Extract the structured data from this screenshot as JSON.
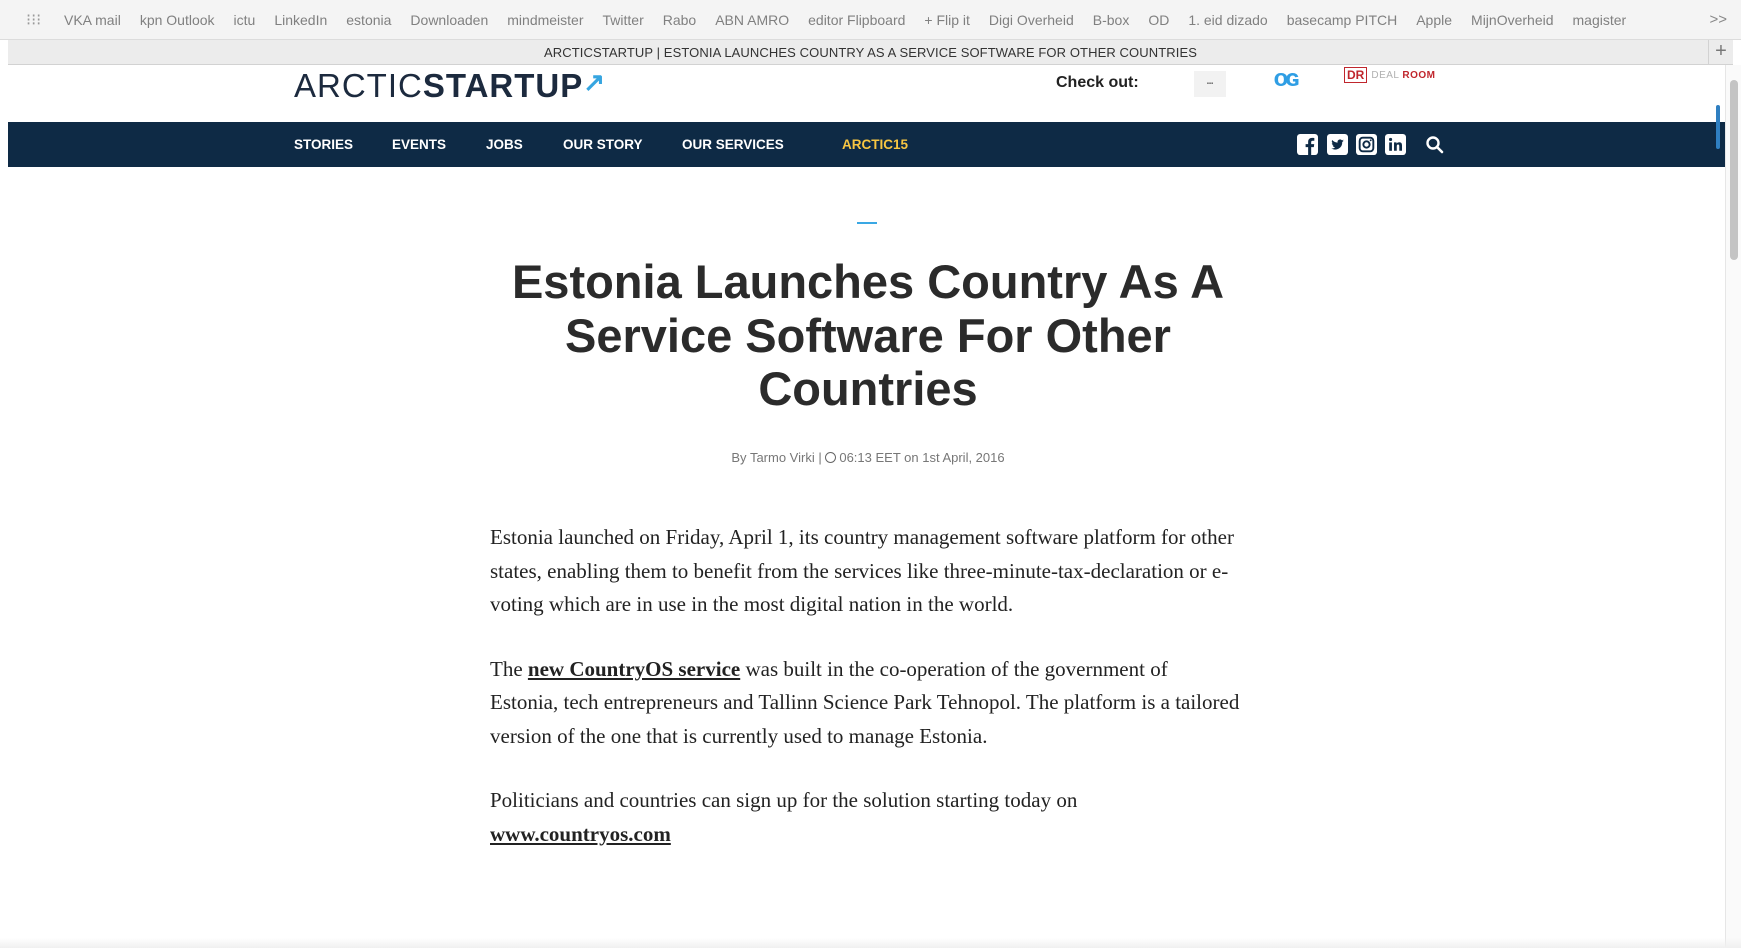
{
  "bookmarks": [
    "VKA mail",
    "kpn Outlook",
    "ictu",
    "LinkedIn",
    "estonia",
    "Downloaden",
    "mindmeister",
    "Twitter",
    "Rabo",
    "ABN AMRO",
    "editor Flipboard",
    "+ Flip it",
    "Digi Overheid",
    "B-box",
    "OD",
    "1. eid dizado",
    "basecamp PITCH",
    "Apple",
    "MijnOverheid",
    "magister"
  ],
  "tab": {
    "title": "ARCTICSTARTUP | ESTONIA LAUNCHES COUNTRY AS A SERVICE SOFTWARE FOR OTHER COUNTRIES"
  },
  "header": {
    "logo_light": "ARCTIC",
    "logo_bold": "STARTUP",
    "checkout_label": "Check out:",
    "partner_dr": "DR",
    "partner_deal": "DEAL",
    "partner_room": "ROOM"
  },
  "nav": {
    "items": [
      "STORIES",
      "EVENTS",
      "JOBS",
      "OUR STORY",
      "OUR SERVICES",
      "ARCTIC15"
    ],
    "accent_color": "#f7c642",
    "background": "#0e2a45",
    "social_icons": [
      "facebook-icon",
      "twitter-icon",
      "instagram-icon",
      "linkedin-icon",
      "search-icon"
    ]
  },
  "article": {
    "title": "Estonia Launches Country As A Service Software For Other Countries",
    "byline_prefix": "By",
    "author": "Tarmo Virki",
    "time": "06:13 EET on 1st April, 2016",
    "p1": "Estonia launched on Friday, April 1, its country management software platform for other states, enabling them to benefit from the services like three-minute-tax-declaration or e-voting which are in use in the most digital nation in the world.",
    "p2_before": "The ",
    "p2_link": "new CountryOS service",
    "p2_after": " was built in the co-operation of the government of Estonia, tech entrepreneurs and Tallinn Science Park Tehnopol. The platform is a tailored version of the one that is currently used to manage Estonia.",
    "p3": "Politicians and countries can sign up for the solution starting today on",
    "p3_link": "www.countryos.com"
  }
}
